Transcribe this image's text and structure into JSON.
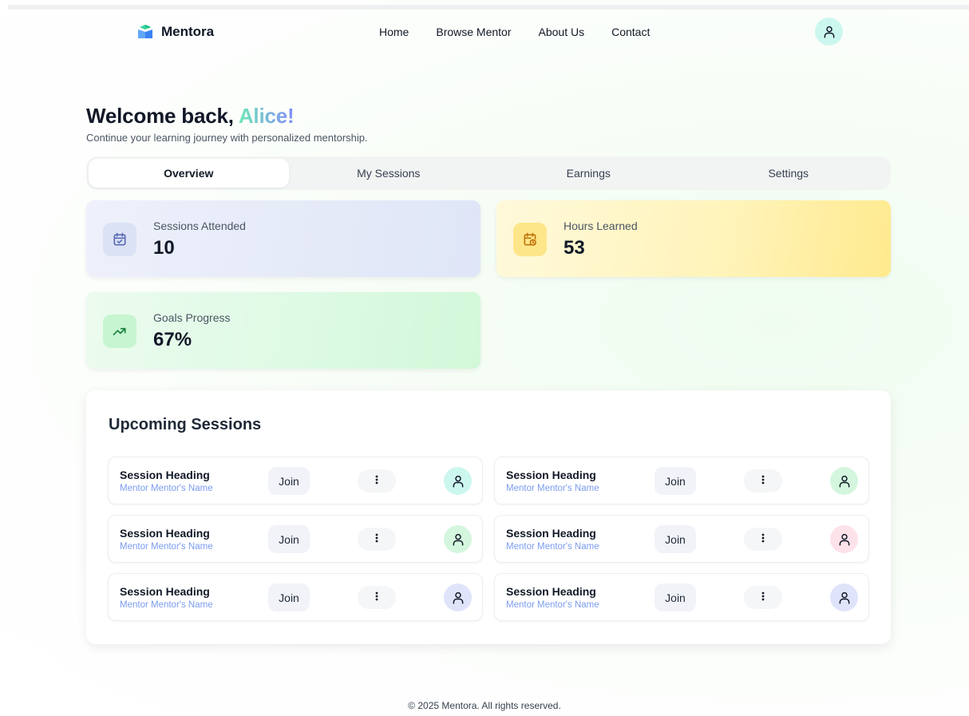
{
  "brand": {
    "name": "Mentora"
  },
  "nav": {
    "items": [
      "Home",
      "Browse Mentor",
      "About Us",
      "Contact"
    ]
  },
  "welcome": {
    "prefix": "Welcome back, ",
    "name": "Alice!",
    "subtitle": "Continue your learning journey with personalized mentorship."
  },
  "tabs": [
    "Overview",
    "My Sessions",
    "Earnings",
    "Settings"
  ],
  "stats": [
    {
      "label": "Sessions Attended",
      "value": "10",
      "icon": "calendar-check-icon"
    },
    {
      "label": "Hours Learned",
      "value": "53",
      "icon": "calendar-clock-icon"
    },
    {
      "label": "Goals Progress",
      "value": "67%",
      "icon": "trending-up-icon"
    }
  ],
  "upcoming": {
    "title": "Upcoming Sessions",
    "join_label": "Join",
    "sessions": [
      {
        "title": "Session Heading",
        "mentor": "Mentor Mentor's Name",
        "avatar_color": "#ccf7ee"
      },
      {
        "title": "Session Heading",
        "mentor": "Mentor Mentor's Name",
        "avatar_color": "#d4f6de"
      },
      {
        "title": "Session Heading",
        "mentor": "Mentor Mentor's Name",
        "avatar_color": "#d4f6de"
      },
      {
        "title": "Session Heading",
        "mentor": "Mentor Mentor's Name",
        "avatar_color": "#fde2ea"
      },
      {
        "title": "Session Heading",
        "mentor": "Mentor Mentor's Name",
        "avatar_color": "#dfe4fb"
      },
      {
        "title": "Session Heading",
        "mentor": "Mentor Mentor's Name",
        "avatar_color": "#dfe4fb"
      }
    ]
  },
  "footer": {
    "text": "© 2025 Mentora. All rights reserved."
  },
  "colors": {
    "accent_blue": "#7c9cef",
    "name_gradient_start": "#6ee7b7",
    "name_gradient_end": "#818cf8"
  }
}
